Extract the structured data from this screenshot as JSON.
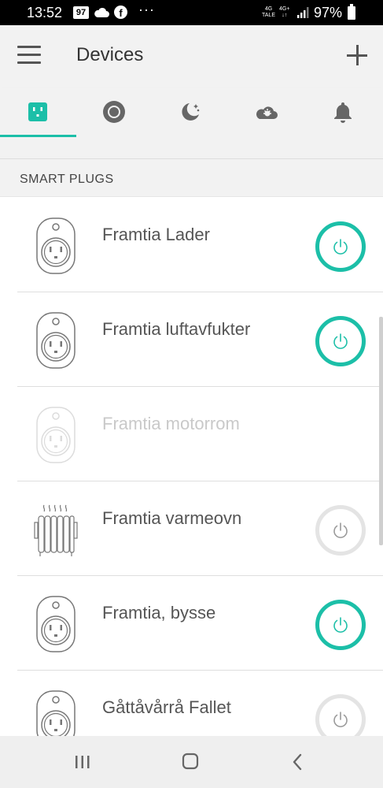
{
  "status_bar": {
    "time": "13:52",
    "badge": "97",
    "facebook": "f",
    "more": "···",
    "net1_top": "4G",
    "net1_bottom": "TALE",
    "net2_top": "4G+",
    "net2_bottom": "↓↑",
    "battery": "97%"
  },
  "app_bar": {
    "title": "Devices"
  },
  "tabs": [
    {
      "icon": "smart-plug-icon",
      "active": true
    },
    {
      "icon": "bulb-icon",
      "active": false
    },
    {
      "icon": "night-moon-icon",
      "active": false
    },
    {
      "icon": "cloud-sun-icon",
      "active": false
    },
    {
      "icon": "bell-icon",
      "active": false
    }
  ],
  "section": {
    "title": "SMART PLUGS"
  },
  "devices": [
    {
      "name": "Framtia Lader",
      "icon": "smart-plug-icon",
      "state": "on"
    },
    {
      "name": "Framtia luftavfukter",
      "icon": "smart-plug-icon",
      "state": "on"
    },
    {
      "name": "Framtia motorrom",
      "icon": "smart-plug-icon",
      "state": "offline"
    },
    {
      "name": "Framtia varmeovn",
      "icon": "radiator-icon",
      "state": "off"
    },
    {
      "name": "Framtia, bysse",
      "icon": "smart-plug-icon",
      "state": "on"
    },
    {
      "name": "Gåttåvårrå Fallet",
      "icon": "smart-plug-icon",
      "state": "off"
    }
  ],
  "colors": {
    "accent": "#1cbfa8",
    "off_ring": "#e4e4e4",
    "text": "#555555"
  },
  "nav_bar": {
    "buttons": [
      "recents-icon",
      "home-icon",
      "back-icon"
    ]
  }
}
